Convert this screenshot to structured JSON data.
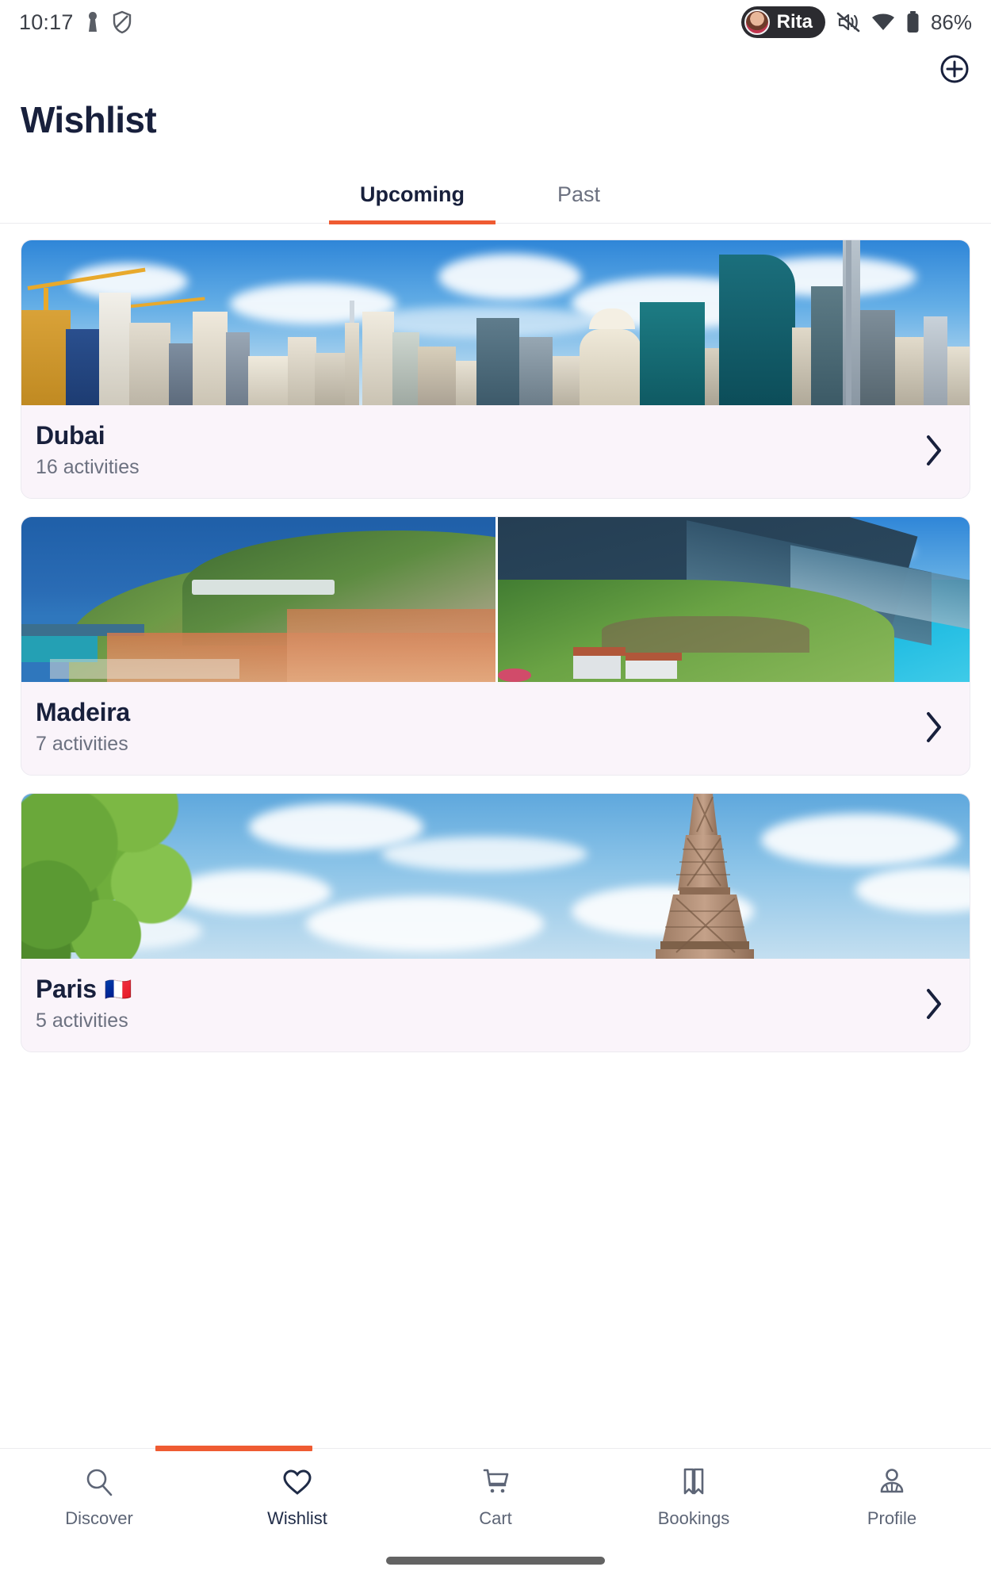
{
  "status_bar": {
    "time": "10:17",
    "icons_left": [
      "key-icon",
      "shield-icon"
    ],
    "user_chip": {
      "name": "Rita",
      "avatar": "user-avatar"
    },
    "icons_right": [
      "mute-icon",
      "wifi-icon",
      "battery-icon"
    ],
    "battery": "86%"
  },
  "header": {
    "title": "Wishlist",
    "add_button": "add-circle-icon"
  },
  "tabs": [
    {
      "label": "Upcoming",
      "active": true
    },
    {
      "label": "Past",
      "active": false
    }
  ],
  "wishlists": [
    {
      "title": "Dubai",
      "flag": "",
      "activities": "16 activities",
      "image": "dubai-skyline",
      "image_count": 1
    },
    {
      "title": "Madeira",
      "flag": "",
      "activities": "7 activities",
      "image": "madeira-funchal-coast",
      "image_count": 2
    },
    {
      "title": "Paris",
      "flag": "🇫🇷",
      "activities": "5 activities",
      "image": "paris-eiffel-tower",
      "image_count": 1
    }
  ],
  "bottom_nav": [
    {
      "label": "Discover",
      "icon": "search-icon",
      "active": false
    },
    {
      "label": "Wishlist",
      "icon": "heart-icon",
      "active": true
    },
    {
      "label": "Cart",
      "icon": "cart-icon",
      "active": false
    },
    {
      "label": "Bookings",
      "icon": "ticket-icon",
      "active": false
    },
    {
      "label": "Profile",
      "icon": "person-icon",
      "active": false
    }
  ],
  "colors": {
    "accent": "#ef5b32",
    "text_dark": "#18203c",
    "text_muted": "#6c7180",
    "card_bg": "#faf4fa",
    "nav_inactive": "#5d6576"
  }
}
